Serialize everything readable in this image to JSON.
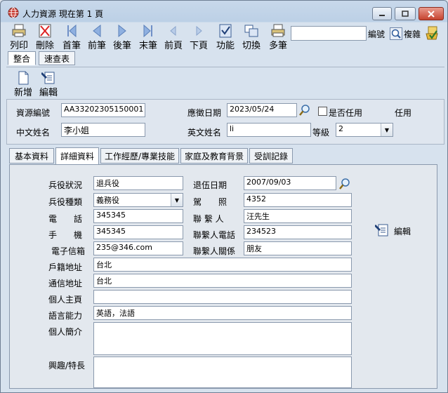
{
  "window": {
    "title": "人力資源  現在第 1 頁"
  },
  "toolbar": {
    "buttons": [
      {
        "label": "列印"
      },
      {
        "label": "刪除"
      },
      {
        "label": "首筆"
      },
      {
        "label": "前筆"
      },
      {
        "label": "後筆"
      },
      {
        "label": "末筆"
      },
      {
        "label": "前頁"
      },
      {
        "label": "下頁"
      },
      {
        "label": "功能"
      },
      {
        "label": "切換"
      },
      {
        "label": "多筆"
      }
    ],
    "search_value": "",
    "search_label": "編號",
    "copy_label": "複雜"
  },
  "view_tabs": [
    {
      "label": "整合"
    },
    {
      "label": "速查表"
    }
  ],
  "actions": {
    "add_label": "新增",
    "edit_label": "編輯"
  },
  "header": {
    "resource_no_label": "資源編號",
    "resource_no": "AA33202305150001",
    "apply_date_label": "應徵日期",
    "apply_date": "2023/05/24",
    "hired_label": "是否任用",
    "hired_status": "任用",
    "name_label": "中文姓名",
    "name": "李小姐",
    "english_name_label": "英文姓名",
    "english_name": "li",
    "grade_label": "等級",
    "grade": "2"
  },
  "tabs": [
    {
      "label": "基本資料"
    },
    {
      "label": "詳細資料"
    },
    {
      "label": "工作經歷/專業技能"
    },
    {
      "label": "家庭及教育背景"
    },
    {
      "label": "受訓記錄"
    }
  ],
  "detail": {
    "military_label": "兵役狀況",
    "military": "退兵役",
    "discharge_date_label": "退伍日期",
    "discharge_date": "2007/09/03",
    "military_type_label": "兵役種類",
    "military_type": "義務役",
    "license_label": "駕　　照",
    "license": "4352",
    "phone_label": "電　　話",
    "phone": "345345",
    "contact_label": "聯 繫 人",
    "contact": "汪先生",
    "mobile_label": "手　　機",
    "mobile": "345345",
    "contact_phone_label": "聯繫人電話",
    "contact_phone": "234523",
    "email_label": "電子信箱",
    "email": "235@346.com",
    "relation_label": "聯繫人關係",
    "relation": "朋友",
    "domicile_label": "戶籍地址",
    "domicile": "台北",
    "mail_addr_label": "通信地址",
    "mail_addr": "台北",
    "homepage_label": "個人主頁",
    "homepage": "",
    "language_label": "語言能力",
    "language": "英語，法語",
    "intro_label": "個人簡介",
    "intro": "",
    "hobby_label": "興趣/特長",
    "hobby": "",
    "edit_label": "編輯"
  }
}
